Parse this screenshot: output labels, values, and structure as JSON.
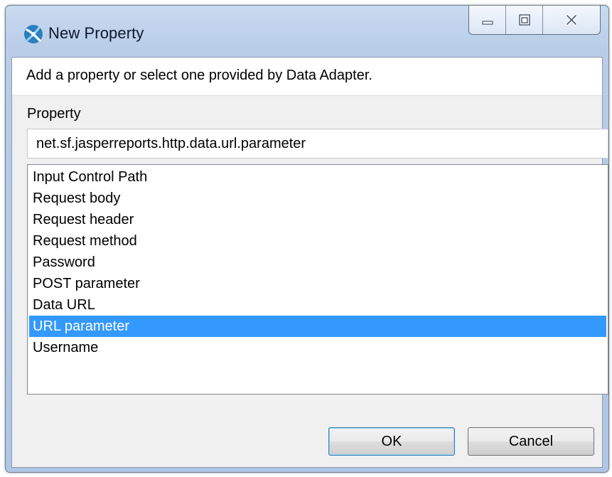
{
  "window": {
    "title": "New Property",
    "app_icon": "jaspersoft-studio-icon",
    "caption_buttons": [
      "minimize-icon",
      "maximize-icon",
      "close-icon"
    ]
  },
  "banner": {
    "message": "Add a property or select one provided by Data Adapter."
  },
  "property": {
    "label": "Property",
    "value": "net.sf.jasperreports.http.data.url.parameter"
  },
  "list": {
    "items": [
      "Input Control Path",
      "Request body",
      "Request header",
      "Request method",
      "Password",
      "POST parameter",
      "Data URL",
      "URL parameter",
      "Username"
    ],
    "selected": "URL parameter"
  },
  "buttons": {
    "ok": "OK",
    "cancel": "Cancel"
  },
  "colors": {
    "selection": "#3399ff",
    "frame": "#b9cde8"
  }
}
